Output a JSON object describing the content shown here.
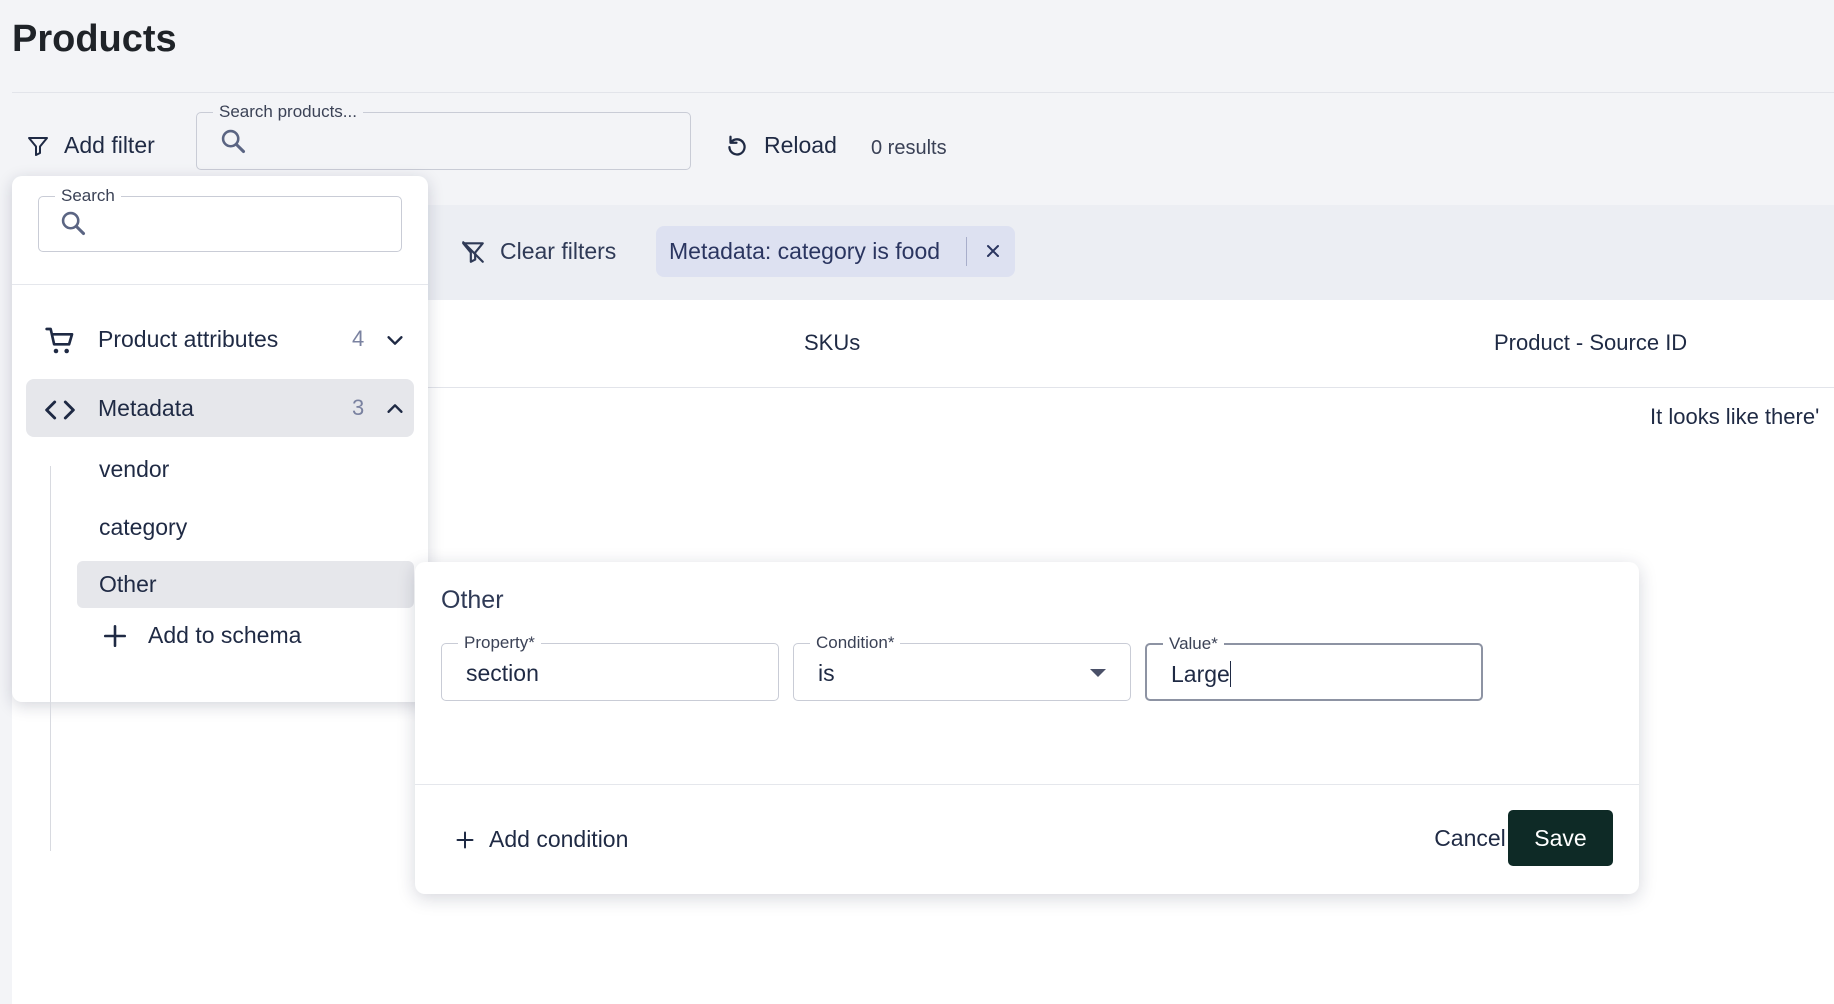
{
  "page": {
    "title": "Products"
  },
  "toolbar": {
    "add_filter_label": "Add filter",
    "search_legend": "Search products...",
    "reload_label": "Reload",
    "results_text": "0 results"
  },
  "filter_bar": {
    "clear_label": "Clear filters",
    "chip_label": "Metadata: category is food"
  },
  "table": {
    "columns": [
      "SKUs",
      "Product - Source ID"
    ],
    "empty_message": "It looks like there'"
  },
  "filter_dropdown": {
    "search_legend": "Search",
    "groups": [
      {
        "label": "Product attributes",
        "count": "4",
        "icon": "cart-icon",
        "expanded": false
      },
      {
        "label": "Metadata",
        "count": "3",
        "icon": "code-icon",
        "expanded": true
      }
    ],
    "metadata_items": [
      "vendor",
      "category",
      "Other"
    ],
    "add_schema_label": "Add to schema"
  },
  "condition_panel": {
    "title": "Other",
    "property": {
      "legend": "Property*",
      "value": "section"
    },
    "condition": {
      "legend": "Condition*",
      "value": "is"
    },
    "value": {
      "legend": "Value*",
      "value": "Large"
    },
    "add_condition_label": "Add condition",
    "cancel_label": "Cancel",
    "save_label": "Save"
  },
  "colors": {
    "primary_button": "#0e2a26",
    "chip_background": "#dde1f1",
    "selected_background": "#e6e7eb"
  }
}
